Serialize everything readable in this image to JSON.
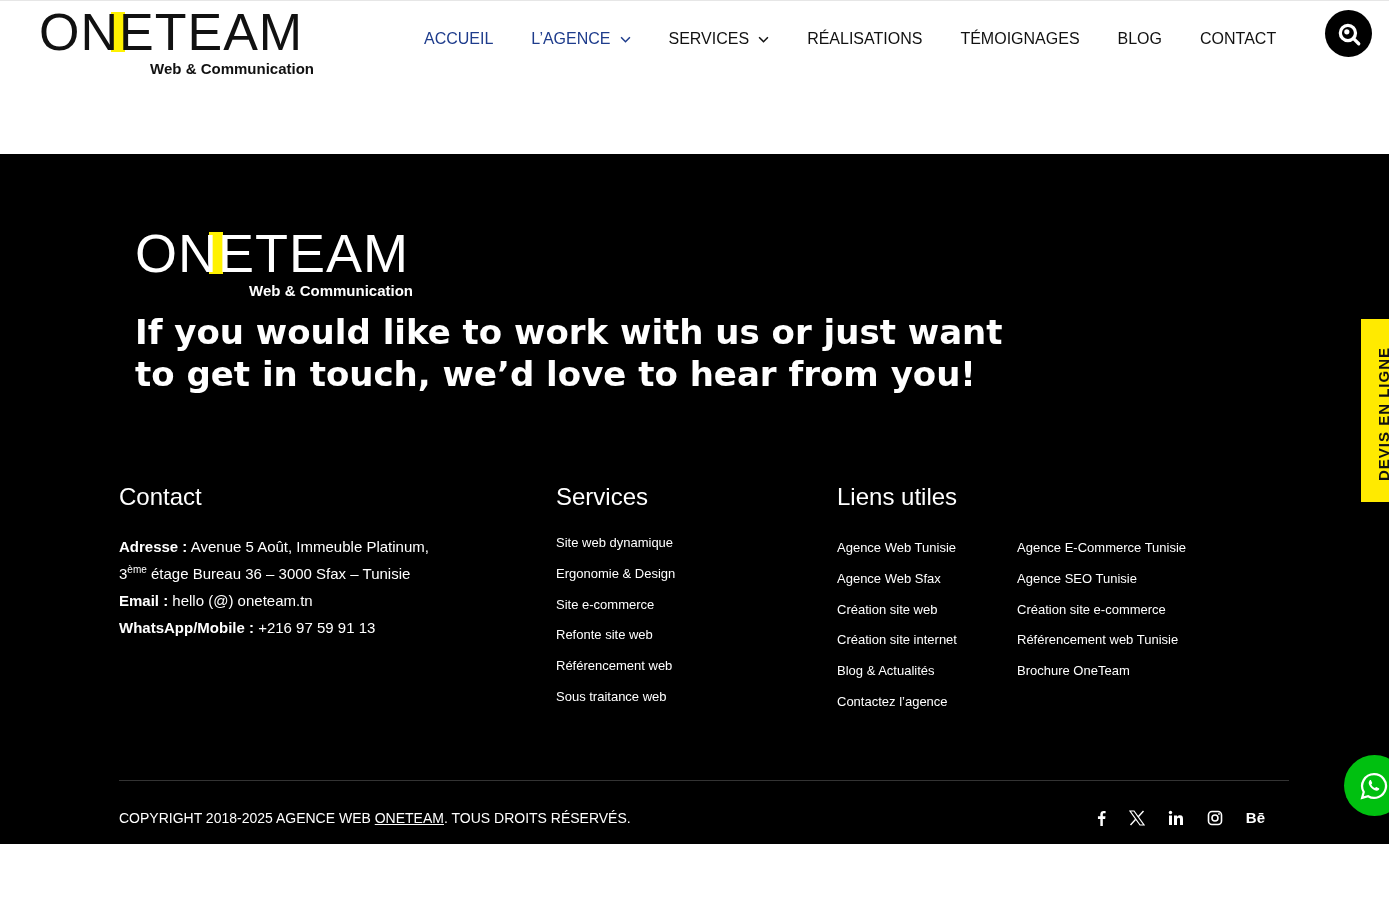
{
  "header": {
    "logo": {
      "wordmark": "ONETEAM",
      "tagline": "Web & Communication"
    },
    "nav": [
      {
        "label": "ACCUEIL",
        "selected": true,
        "has_menu": false
      },
      {
        "label": "L’AGENCE",
        "selected": true,
        "has_menu": true
      },
      {
        "label": "SERVICES",
        "selected": false,
        "has_menu": true
      },
      {
        "label": "RÉALISATIONS",
        "selected": false,
        "has_menu": false
      },
      {
        "label": "TÉMOIGNAGES",
        "selected": false,
        "has_menu": false
      },
      {
        "label": "BLOG",
        "selected": false,
        "has_menu": false
      },
      {
        "label": "CONTACT",
        "selected": false,
        "has_menu": false
      }
    ]
  },
  "footer": {
    "logo": {
      "wordmark": "ONETEAM",
      "tagline": "Web & Communication"
    },
    "headline": "If you would like to work with us or just want to get in touch, we’d love to hear from you!",
    "contact": {
      "title": "Contact",
      "lines": [
        "**Adresse :** Avenue 5 Août, Immeuble Platinum, 3$^{ème}$ étage Bureau 36 – 3000 Sfax – Tunisie",
        "**Email :** hello (@) oneteam.tn",
        "**WhatsApp/Mobile :** +216 97 59 91 13"
      ]
    },
    "services": {
      "title": "Services",
      "links": [
        "Site web dynamique",
        "Ergonomie & Design",
        "Site e-commerce",
        "Refonte site web",
        "Référencement web",
        "Sous traitance web"
      ]
    },
    "useful_links": {
      "title": "Liens utiles",
      "columns": [
        [
          "Agence Web Tunisie",
          "Agence Web Sfax",
          "Création site web",
          "Création site internet",
          "Blog & Actualités",
          "Contactez l’agence"
        ],
        [
          "Agence E-Commerce Tunisie",
          "Agence SEO Tunisie",
          "Création site e-commerce",
          "Référencement web Tunisie",
          "Brochure OneTeam"
        ]
      ]
    },
    "copyright": {
      "before": "COPYRIGHT 2018-2025 AGENCE WEB ",
      "link": "ONETEAM",
      "after": ". TOUS DROITS RÉSERVÉS."
    },
    "social": [
      {
        "kind": "facebook"
      },
      {
        "kind": "x"
      },
      {
        "kind": "linkedin"
      },
      {
        "kind": "instagram"
      },
      {
        "kind": "behance",
        "text": "Bē"
      }
    ]
  },
  "quote_tab": "DEVIS EN LIGNE"
}
